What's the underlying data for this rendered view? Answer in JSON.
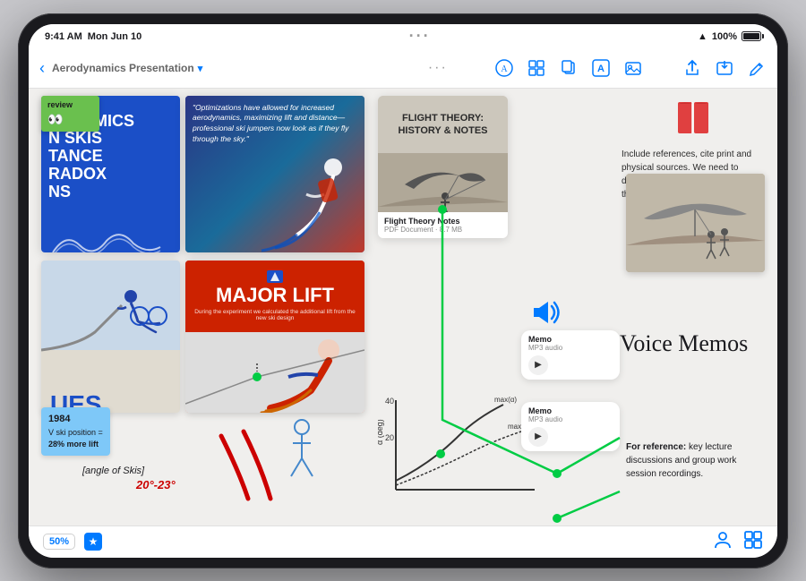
{
  "device": {
    "status_bar": {
      "time": "9:41 AM",
      "day": "Mon Jun 10",
      "signal_dots": "•••",
      "wifi": "WiFi",
      "battery_pct": "100%"
    },
    "toolbar": {
      "back_label": "< ",
      "title": "Aerodynamics Presentation",
      "dropdown_arrow": "∨",
      "dots": "•••",
      "icons": [
        "circle-a-icon",
        "grid-icon",
        "copy-icon",
        "text-a-icon",
        "photo-icon",
        "share-icon",
        "export-icon",
        "edit-icon"
      ]
    },
    "canvas": {
      "slide_blue": {
        "tag": "NS",
        "lines": [
          "DYNAMICS",
          "N SKIS",
          "STANCE",
          "RADOX",
          "NS"
        ]
      },
      "slide_photo_quote": "\"Optimizations have allowed for increased aerodynamics, maximizing lift and distance—professional ski jumpers now look as if they fly through the sky.\"",
      "sticky_review": {
        "label": "review",
        "eyes": "👀"
      },
      "pdf_card": {
        "title": "FLIGHT THEORY: HISTORY & NOTES",
        "name": "Flight Theory Notes",
        "type": "PDF Document",
        "size": "8.7 MB"
      },
      "ref_text": "Include references, cite print and physical sources. We need to demonstrate how we researched theory and concepts.",
      "issues_label": "UES",
      "major_lift": {
        "title": "MAJOR LIFT",
        "body": "During the experiment we calculated the additional lift from the new ski design"
      },
      "stat_note": {
        "year": "1984",
        "detail": "V ski position =",
        "value": "28% more lift"
      },
      "angle_text": "20°-23°",
      "angle_label": "[angle of Skis]",
      "voice_memos_title": "Voice Memos",
      "voice_memo_1": {
        "label": "Memo",
        "sub": "MP3 audio"
      },
      "voice_memo_2": {
        "label": "Memo",
        "sub": "MP3 audio"
      },
      "memo_ref": "For reference: key lecture discussions and group work session recordings."
    },
    "bottom_bar": {
      "zoom": "50%",
      "star_icon": "★",
      "icons": [
        "person-icon",
        "grid-icon"
      ]
    }
  }
}
